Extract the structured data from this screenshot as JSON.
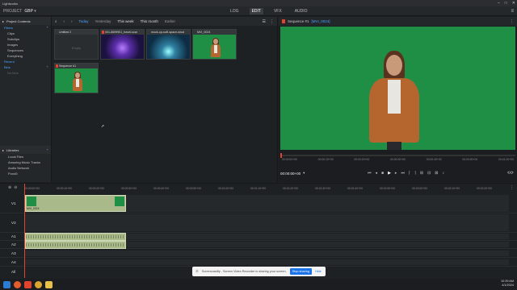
{
  "app": {
    "title": "Lightworks"
  },
  "topnav": {
    "project_label": "PROJECT",
    "project_name": "GBP",
    "tabs": [
      {
        "label": "LOG",
        "active": false
      },
      {
        "label": "EDIT",
        "active": true
      },
      {
        "label": "VFX",
        "active": false
      },
      {
        "label": "AUDIO",
        "active": false
      }
    ]
  },
  "project_contents": {
    "title": "Project Contents",
    "items": [
      {
        "label": "Filters",
        "type": "cat"
      },
      {
        "label": "Clips",
        "type": "item"
      },
      {
        "label": "Subclips",
        "type": "item"
      },
      {
        "label": "Images",
        "type": "item"
      },
      {
        "label": "Sequences",
        "type": "item"
      },
      {
        "label": "Everything",
        "type": "item"
      },
      {
        "label": "Recent",
        "type": "cat"
      },
      {
        "label": "Bins",
        "type": "cat"
      },
      {
        "label": "No bins",
        "type": "dim"
      }
    ],
    "libraries_title": "Libraries",
    "libraries": [
      "Local Files",
      "Amazing Music Tracks",
      "Audio Network",
      "Pond5"
    ]
  },
  "browser": {
    "filters": [
      {
        "label": "Today",
        "active": true
      },
      {
        "label": "Yesterday",
        "active": false
      },
      {
        "label": "This week",
        "active": false
      },
      {
        "label": "This month",
        "active": false
      },
      {
        "label": "Earlier",
        "active": false
      }
    ],
    "clips": [
      {
        "title": "Untitled 2",
        "kind": "empty",
        "sub": "Empty"
      },
      {
        "title": "001-8699901_travel-scar",
        "kind": "space1"
      },
      {
        "title": "mock-up-scifi-space-shud",
        "kind": "space2"
      },
      {
        "title": "MVI_0024",
        "kind": "green"
      },
      {
        "title": "Sequence #1",
        "kind": "green"
      }
    ]
  },
  "viewer": {
    "title": "Sequence #1",
    "clip": "[MVI_0024]",
    "timecode": "00:00:00+00",
    "ruler": [
      "00:00:00+00",
      "00:00:10+00",
      "00:00:20+00",
      "00:00:30+00",
      "00:00:40+00",
      "00:00:50+00",
      "00:01:00+00"
    ]
  },
  "timeline": {
    "ruler": [
      "00:00:00+00",
      "00:00:10+00",
      "00:00:20+00",
      "00:00:30+00",
      "00:00:40+00",
      "00:00:50+00",
      "00:01:00+00",
      "00:01:10+00",
      "00:01:20+00",
      "00:01:30+00",
      "00:01:40+00",
      "00:01:50+00",
      "00:02:00+00",
      "00:02:10+00",
      "00:02:20+00"
    ],
    "tracks": [
      "V1",
      "V2",
      "A1",
      "A2",
      "A3",
      "A4",
      "All"
    ],
    "video_clip_name": "MVI_0024",
    "audio_clip_name": "MVI_0024 A1"
  },
  "share_banner": {
    "message": "Screencastify - Screen Video Recorder is sharing your screen.",
    "stop_label": "Stop sharing",
    "hide_label": "Hide"
  },
  "taskbar": {
    "time": "10:39 AM",
    "date": "4/1/2024"
  },
  "colors": {
    "accent": "#4aa3ff",
    "record": "#e0442e",
    "green_screen": "#1f8f45",
    "clip": "#a9b98a"
  }
}
